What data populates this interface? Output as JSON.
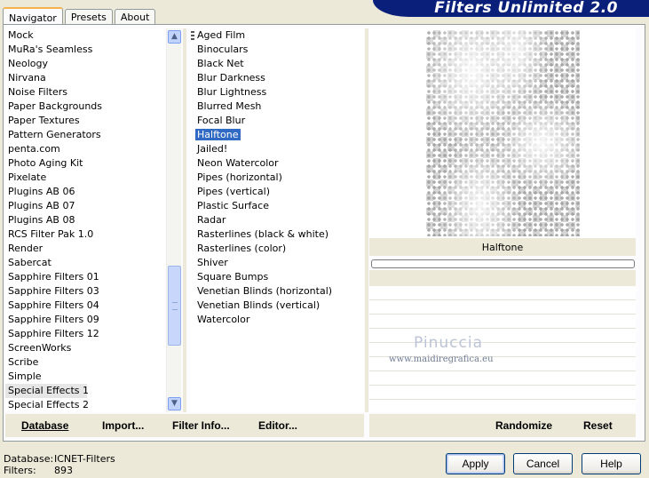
{
  "tabs": [
    "Navigator",
    "Presets",
    "About"
  ],
  "banner_title": "Filters Unlimited 2.0",
  "categories": [
    "Mock",
    "MuRa's Seamless",
    "Neology",
    "Nirvana",
    "Noise Filters",
    "Paper Backgrounds",
    "Paper Textures",
    "Pattern Generators",
    "penta.com",
    "Photo Aging Kit",
    "Pixelate",
    "Plugins AB 06",
    "Plugins AB 07",
    "Plugins AB 08",
    "RCS Filter Pak 1.0",
    "Render",
    "Sabercat",
    "Sapphire Filters 01",
    "Sapphire Filters 03",
    "Sapphire Filters 04",
    "Sapphire Filters 09",
    "Sapphire Filters 12",
    "ScreenWorks",
    "Scribe",
    "Simple",
    "Special Effects 1",
    "Special Effects 2"
  ],
  "selected_category": "Special Effects 1",
  "filters": [
    "Aged Film",
    "Binoculars",
    "Black Net",
    "Blur Darkness",
    "Blur Lightness",
    "Blurred Mesh",
    "Focal Blur",
    "Halftone",
    "Jailed!",
    "Neon Watercolor",
    "Pipes (horizontal)",
    "Pipes (vertical)",
    "Plastic Surface",
    "Radar",
    "Rasterlines (black & white)",
    "Rasterlines (color)",
    "Shiver",
    "Square Bumps",
    "Venetian Blinds (horizontal)",
    "Venetian Blinds (vertical)",
    "Watercolor"
  ],
  "selected_filter": "Halftone",
  "preview_filter_name": "Halftone",
  "progress": 0,
  "watermark": {
    "name": "Pinuccia",
    "url": "www.maidiregrafica.eu"
  },
  "toolbar": {
    "database": "Database",
    "import": "Import...",
    "filter_info": "Filter Info...",
    "editor": "Editor...",
    "randomize": "Randomize",
    "reset": "Reset"
  },
  "status": {
    "database_label": "Database:",
    "database_value": "ICNET-Filters",
    "filters_label": "Filters:",
    "filters_value": "893"
  },
  "buttons": {
    "apply": "Apply",
    "cancel": "Cancel",
    "help": "Help"
  },
  "colors": {
    "selection": "#316ac5",
    "banner": "#0a1f7a",
    "tab_accent": "#f5b14a"
  },
  "icons": {
    "scroll_up": "up-arrow-icon",
    "scroll_down": "down-arrow-icon"
  }
}
